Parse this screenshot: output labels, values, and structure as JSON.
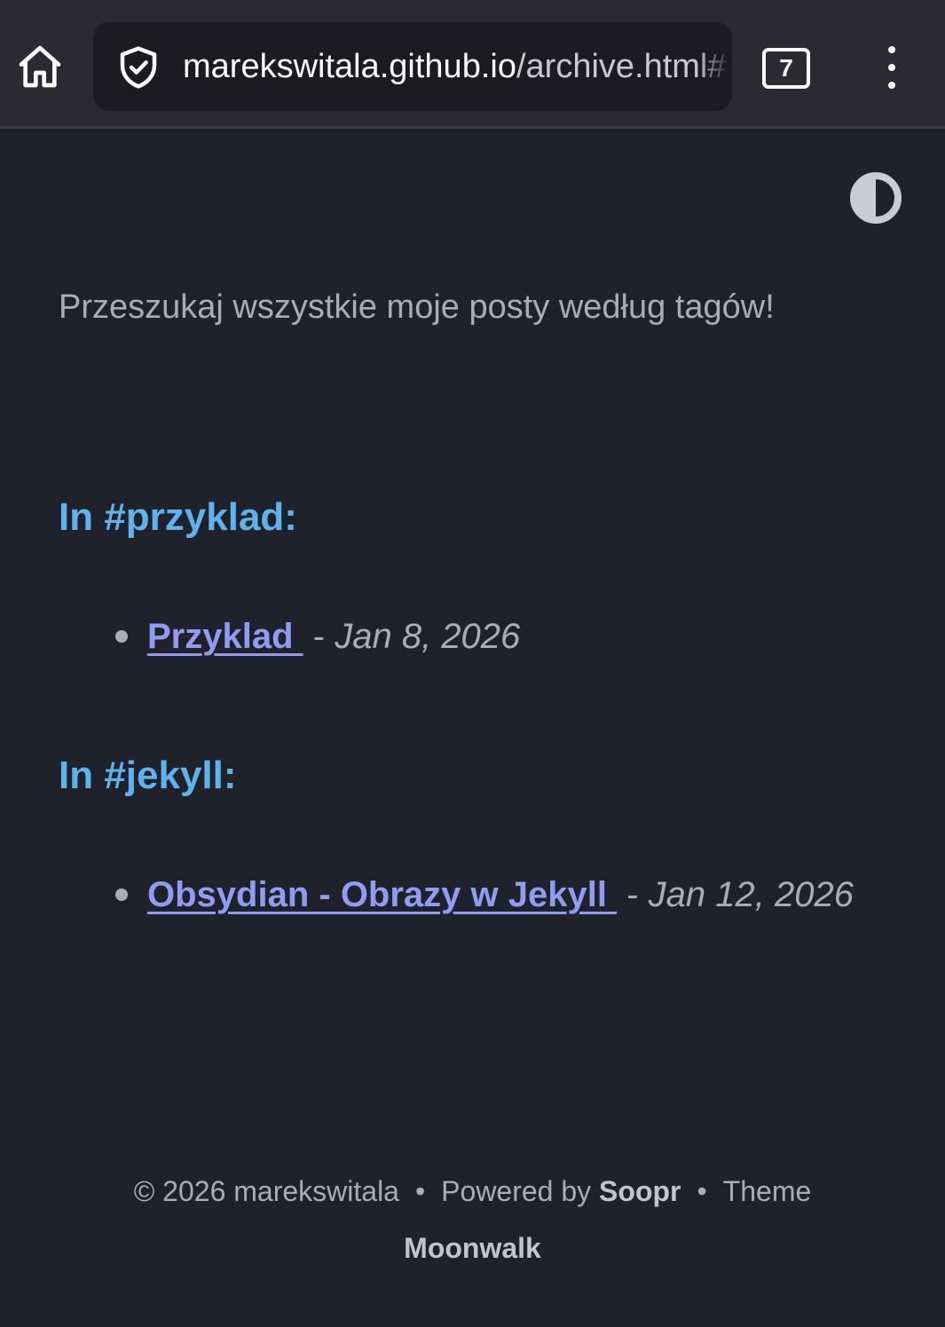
{
  "browser": {
    "url_host": "marekswitala.github.io",
    "url_path": "/archive.html#",
    "tab_count": "7"
  },
  "page": {
    "intro": "Przeszukaj wszystkie moje posty według tagów!",
    "tags": [
      {
        "heading": "In #przyklad:",
        "posts": [
          {
            "title": "Przyklad",
            "separator": "-",
            "date": "Jan 8, 2026"
          }
        ]
      },
      {
        "heading": "In #jekyll:",
        "posts": [
          {
            "title": "Obsydian - Obrazy w Jekyll",
            "separator": "-",
            "date": "Jan 12, 2026"
          }
        ]
      }
    ]
  },
  "footer": {
    "copyright": "© 2026 marekswitala",
    "bullet": "•",
    "powered_prefix": "Powered by",
    "powered_name": "Soopr",
    "theme_prefix": "Theme",
    "theme_name": "Moonwalk"
  },
  "colors": {
    "background": "#1f222a",
    "heading": "#5fb2ee",
    "link": "#8f9cf1",
    "muted_text": "#a9adb4",
    "chrome": "#2b2a33"
  },
  "icons": [
    "home-icon",
    "shield-check-icon",
    "tabs-counter-icon",
    "kebab-menu-icon",
    "theme-toggle-icon"
  ]
}
